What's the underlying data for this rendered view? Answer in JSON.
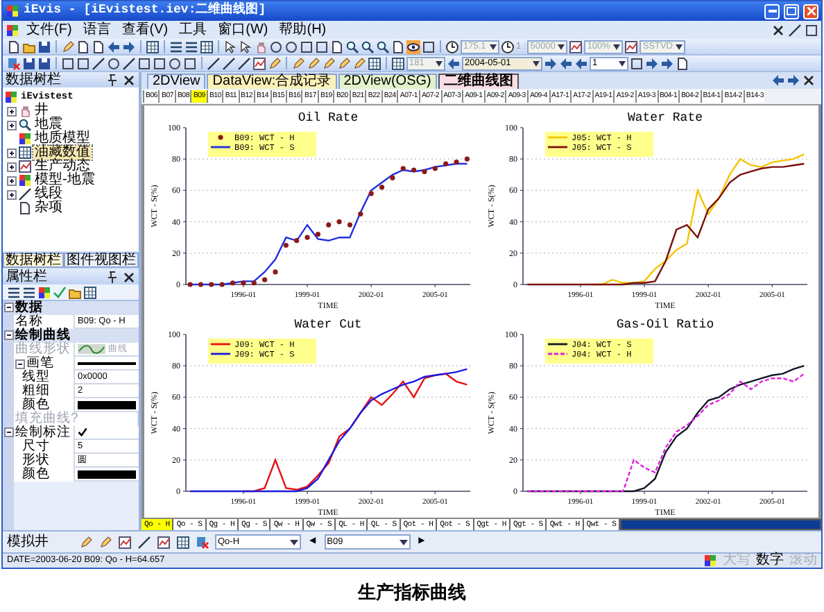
{
  "window": {
    "title": "iEvis - [iEvistest.iev:二维曲线图]"
  },
  "menu": [
    "文件(F)",
    "语言",
    "查看(V)",
    "工具",
    "窗口(W)",
    "帮助(H)"
  ],
  "toolbars": [
    {
      "combos": [
        {
          "kind": "combo",
          "value": "175.1",
          "disabled": true
        },
        {
          "kind": "label",
          "value": "1 :",
          "disabled": true
        },
        {
          "kind": "combo",
          "value": "50000",
          "disabled": true
        },
        {
          "kind": "combo",
          "value": "100%",
          "disabled": true
        },
        {
          "kind": "combo",
          "value": "SSTVD",
          "disabled": true
        }
      ]
    },
    {
      "combos": [
        {
          "kind": "combo",
          "value": "181",
          "disabled": true
        },
        {
          "kind": "combo",
          "value": "2004-05-01",
          "disabled": false
        },
        {
          "kind": "combo",
          "value": "1",
          "disabled": false
        }
      ]
    }
  ],
  "data_tree": {
    "title": "数据树栏",
    "root": {
      "label": "iEvistest",
      "children": [
        {
          "label": "井",
          "expanded": false,
          "selected": false
        },
        {
          "label": "地震",
          "expanded": false,
          "selected": false
        },
        {
          "label": "地质模型",
          "selected": false
        },
        {
          "label": "油藏数值",
          "expanded": false,
          "selected": true
        },
        {
          "label": "生产动态",
          "expanded": false,
          "selected": false
        },
        {
          "label": "模型-地震",
          "expanded": false,
          "selected": false
        },
        {
          "label": "线段",
          "expanded": false,
          "selected": false
        },
        {
          "label": "杂项",
          "selected": false
        }
      ]
    }
  },
  "panel_tabs": [
    {
      "label": "数据树栏",
      "selected": true
    },
    {
      "label": "图件视图栏",
      "selected": false
    }
  ],
  "properties": {
    "title": "属性栏",
    "rows": [
      {
        "kind": "category",
        "label": "数据",
        "expanded": true,
        "disabled": false,
        "children": [
          {
            "kind": "text",
            "label": "名称",
            "value": "B09: Qo - H",
            "disabled": false
          }
        ]
      },
      {
        "kind": "category",
        "label": "绘制曲线",
        "expanded": true,
        "disabled": false,
        "children": [
          {
            "kind": "curve",
            "label": "曲线形状",
            "value": "曲线",
            "disabled": true
          },
          {
            "kind": "pen",
            "label": "画笔",
            "expanded": true,
            "disabled": false,
            "children": [
              {
                "kind": "text",
                "label": "线型",
                "value": "0x0000",
                "disabled": false
              },
              {
                "kind": "text",
                "label": "粗细",
                "value": "2",
                "disabled": false
              },
              {
                "kind": "color",
                "label": "颜色",
                "color": "#000000",
                "disabled": false
              }
            ]
          },
          {
            "kind": "text",
            "label": "填充曲线?",
            "disabled": true
          }
        ]
      },
      {
        "kind": "check",
        "label": "绘制标注",
        "expanded": true,
        "checked": true,
        "disabled": false,
        "children": [
          {
            "kind": "text",
            "label": "尺寸",
            "value": "5",
            "disabled": false
          },
          {
            "kind": "text",
            "label": "形状",
            "value": "圆",
            "disabled": false
          },
          {
            "kind": "color",
            "label": "颜色",
            "color": "#000000",
            "disabled": false
          }
        ]
      }
    ]
  },
  "view_tabs": [
    {
      "label": "2DView",
      "selected": false,
      "color": "#dfe8f8"
    },
    {
      "label": "DataView:合成记录",
      "selected": false,
      "color": "#fbf0b8"
    },
    {
      "label": "2DView(OSG)",
      "selected": false,
      "color": "#e4f2cc"
    },
    {
      "label": "二维曲线图",
      "selected": true,
      "color": "#f8dde4"
    }
  ],
  "well_tabs": [
    {
      "label": "B06",
      "selected": false
    },
    {
      "label": "B07",
      "selected": false
    },
    {
      "label": "B08",
      "selected": false
    },
    {
      "label": "B09",
      "selected": true
    },
    {
      "label": "B10",
      "selected": false
    },
    {
      "label": "B11",
      "selected": false
    },
    {
      "label": "B12",
      "selected": false
    },
    {
      "label": "B14",
      "selected": false
    },
    {
      "label": "B15",
      "selected": false
    },
    {
      "label": "B16",
      "selected": false
    },
    {
      "label": "B17",
      "selected": false
    },
    {
      "label": "B19",
      "selected": false
    },
    {
      "label": "B20",
      "selected": false
    },
    {
      "label": "B21",
      "selected": false
    },
    {
      "label": "B22",
      "selected": false
    },
    {
      "label": "B24",
      "selected": false
    },
    {
      "label": "A07-1",
      "selected": false
    },
    {
      "label": "A07-2",
      "selected": false
    },
    {
      "label": "A07-3",
      "selected": false
    },
    {
      "label": "A09-1",
      "selected": false
    },
    {
      "label": "A09-2",
      "selected": false
    },
    {
      "label": "A09-3",
      "selected": false
    },
    {
      "label": "A09-4",
      "selected": false
    },
    {
      "label": "A17-1",
      "selected": false
    },
    {
      "label": "A17-2",
      "selected": false
    },
    {
      "label": "A19-1",
      "selected": false
    },
    {
      "label": "A19-2",
      "selected": false
    },
    {
      "label": "A19-3",
      "selected": false
    },
    {
      "label": "B04-1",
      "selected": false
    },
    {
      "label": "B04-2",
      "selected": false
    },
    {
      "label": "B14-1",
      "selected": false
    },
    {
      "label": "B14-2",
      "selected": false
    },
    {
      "label": "B14-3",
      "selected": false
    }
  ],
  "charts": [
    {
      "chart_data": {
        "type": "line",
        "title": "Oil Rate",
        "grid": true,
        "legend": "upper left",
        "xlabel": "TIME",
        "ylabel": "WCT - S(%)",
        "categories": [
          null,
          null,
          null,
          null,
          null,
          "1996-01",
          null,
          null,
          null,
          null,
          null,
          "1999-01",
          null,
          null,
          null,
          null,
          null,
          "2002-01",
          null,
          null,
          null,
          null,
          null,
          "2005-01",
          null,
          null,
          null
        ],
        "ylim": [
          0,
          100
        ],
        "yticks": [
          0,
          20,
          40,
          60,
          80,
          100
        ],
        "series": [
          {
            "name": "B09: WCT - H",
            "color": "#8b1a1a",
            "type": "scatter",
            "values": [
              0,
              0,
              0,
              0,
              1,
              1,
              1,
              3,
              8,
              25,
              28,
              30,
              32,
              38,
              40,
              38,
              45,
              58,
              62,
              68,
              74,
              73,
              72,
              74,
              77,
              78,
              80
            ]
          },
          {
            "name": "B09: WCT - S",
            "color": "#1f2fe0",
            "type": "line",
            "line_style": "solid",
            "values": [
              0,
              0,
              0,
              0,
              1,
              2,
              2,
              8,
              16,
              30,
              28,
              38,
              29,
              28,
              30,
              30,
              46,
              60,
              65,
              70,
              73,
              72,
              73,
              75,
              76,
              77,
              77
            ]
          }
        ]
      }
    },
    {
      "chart_data": {
        "type": "line",
        "title": "Water Rate",
        "grid": true,
        "legend": "upper left",
        "xlabel": "TIME",
        "ylabel": "WCT - S(%)",
        "categories": [
          null,
          null,
          null,
          null,
          null,
          "1996-01",
          null,
          null,
          null,
          null,
          null,
          "1999-01",
          null,
          null,
          null,
          null,
          null,
          "2002-01",
          null,
          null,
          null,
          null,
          null,
          "2005-01",
          null,
          null,
          null
        ],
        "ylim": [
          0,
          100
        ],
        "yticks": [
          0,
          20,
          40,
          60,
          80,
          100
        ],
        "series": [
          {
            "name": "J05: WCT - H",
            "color": "#f5c400",
            "type": "line",
            "line_style": "solid",
            "values": [
              null,
              null,
              null,
              null,
              null,
              null,
              0,
              0,
              3,
              1,
              1,
              2,
              10,
              15,
              22,
              26,
              60,
              45,
              55,
              70,
              80,
              76,
              75,
              78,
              79,
              80,
              83
            ]
          },
          {
            "name": "J05: WCT - S",
            "color": "#7a1010",
            "type": "line",
            "line_style": "solid",
            "values": [
              0,
              0,
              0,
              0,
              0,
              0,
              0,
              0,
              0,
              0,
              1,
              1,
              2,
              15,
              35,
              38,
              30,
              48,
              55,
              65,
              70,
              72,
              74,
              75,
              75,
              76,
              77
            ]
          }
        ]
      }
    },
    {
      "chart_data": {
        "type": "line",
        "title": "Water Cut",
        "grid": true,
        "legend": "upper left",
        "xlabel": "TIME",
        "ylabel": "WCT - S(%)",
        "categories": [
          null,
          null,
          null,
          null,
          null,
          "1996-01",
          null,
          null,
          null,
          null,
          null,
          "1999-01",
          null,
          null,
          null,
          null,
          null,
          "2002-01",
          null,
          null,
          null,
          null,
          null,
          "2005-01",
          null,
          null,
          null
        ],
        "ylim": [
          0,
          100
        ],
        "yticks": [
          0,
          20,
          40,
          60,
          80,
          100
        ],
        "series": [
          {
            "name": "J09: WCT - H",
            "color": "#e81010",
            "type": "line",
            "line_style": "solid",
            "values": [
              null,
              null,
              null,
              null,
              null,
              0,
              0,
              2,
              20,
              2,
              1,
              3,
              10,
              18,
              35,
              40,
              50,
              60,
              55,
              62,
              70,
              60,
              72,
              74,
              75,
              70,
              68
            ]
          },
          {
            "name": "J09: WCT - S",
            "color": "#1a1ae0",
            "type": "line",
            "line_style": "solid",
            "values": [
              0,
              0,
              0,
              0,
              0,
              0,
              0,
              0,
              0,
              0,
              0,
              2,
              8,
              20,
              32,
              40,
              50,
              58,
              62,
              65,
              68,
              70,
              73,
              74,
              75,
              76,
              78
            ]
          }
        ]
      }
    },
    {
      "chart_data": {
        "type": "line",
        "title": "Gas-Oil Ratio",
        "grid": true,
        "legend": "upper left",
        "xlabel": "TIME",
        "ylabel": "WCT - S(%)",
        "categories": [
          null,
          null,
          null,
          null,
          null,
          "1996-01",
          null,
          null,
          null,
          null,
          null,
          "1999-01",
          null,
          null,
          null,
          null,
          null,
          "2002-01",
          null,
          null,
          null,
          null,
          null,
          "2005-01",
          null,
          null,
          null
        ],
        "ylim": [
          0,
          100
        ],
        "yticks": [
          0,
          20,
          40,
          60,
          80,
          100
        ],
        "series": [
          {
            "name": "J04: WCT - S",
            "color": "#101828",
            "type": "line",
            "line_style": "solid",
            "values": [
              0,
              0,
              0,
              0,
              0,
              0,
              0,
              0,
              0,
              0,
              0,
              2,
              8,
              25,
              35,
              40,
              50,
              58,
              60,
              65,
              68,
              70,
              72,
              74,
              75,
              78,
              80
            ]
          },
          {
            "name": "J04: WCT - H",
            "color": "#e020e0",
            "type": "line",
            "line_style": "dashed",
            "values": [
              0,
              0,
              0,
              0,
              0,
              0,
              0,
              0,
              0,
              0,
              20,
              15,
              12,
              28,
              38,
              42,
              48,
              55,
              58,
              62,
              70,
              65,
              70,
              72,
              72,
              70,
              75
            ]
          }
        ]
      }
    }
  ],
  "curve_tabs": [
    {
      "label": "Qo - H",
      "selected": true
    },
    {
      "label": "Qo - S",
      "selected": false
    },
    {
      "label": "Qg - H",
      "selected": false
    },
    {
      "label": "Qg - S",
      "selected": false
    },
    {
      "label": "Qw - H",
      "selected": false
    },
    {
      "label": "Qw - S",
      "selected": false
    },
    {
      "label": "QL - H",
      "selected": false
    },
    {
      "label": "QL - S",
      "selected": false
    },
    {
      "label": "Qot - H",
      "selected": false
    },
    {
      "label": "Qot - S",
      "selected": false
    },
    {
      "label": "Qgt - H",
      "selected": false
    },
    {
      "label": "Qgt - S",
      "selected": false
    },
    {
      "label": "Qwt - H",
      "selected": false
    },
    {
      "label": "Qwt - S",
      "selected": false
    }
  ],
  "bottom_toolbar": {
    "label": "模拟井",
    "curve_combo": "Qo-H",
    "prev": "◀",
    "well_combo": "B09",
    "next": "▶"
  },
  "status_bar": {
    "text": "DATE=2003-06-20 B09: Qo - H=64.657",
    "indicators": [
      {
        "label": "大写",
        "on": false
      },
      {
        "label": "数字",
        "on": true
      },
      {
        "label": "滚动",
        "on": false
      }
    ]
  },
  "caption": "生产指标曲线"
}
